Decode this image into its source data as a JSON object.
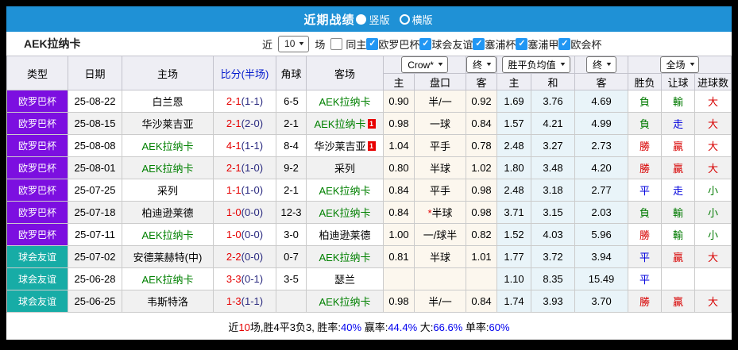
{
  "title_bar": {
    "title": "近期战绩",
    "radio_vertical_label": "竖版",
    "radio_horizontal_label": "横版",
    "bar_color": "#1f91d6"
  },
  "filter_bar": {
    "team": "AEK拉纳卡",
    "recent_label": "近",
    "recent_value": "10",
    "matches_label": "场",
    "same_home_label": "同主",
    "same_home_checked": false,
    "leagues": [
      {
        "label": "欧罗巴杯",
        "checked": true
      },
      {
        "label": "球会友谊",
        "checked": true
      },
      {
        "label": "塞浦杯",
        "checked": true
      },
      {
        "label": "塞浦甲",
        "checked": true
      },
      {
        "label": "欧会杯",
        "checked": true
      }
    ]
  },
  "table": {
    "main_columns": [
      "类型",
      "日期",
      "主场",
      "比分(半场)",
      "角球",
      "客场"
    ],
    "sub_columns": [
      "主",
      "盘口",
      "客",
      "主",
      "和",
      "客",
      "胜负",
      "让球",
      "进球数"
    ],
    "selects": {
      "company": "Crow*",
      "company_time": "终",
      "avg": "胜平负均值",
      "avg_time": "终",
      "scope": "全场"
    },
    "type_colors": {
      "欧罗巴杯": "#7c0fe0",
      "球会友谊": "#17aca6"
    },
    "value_colors": {
      "勝": "red",
      "贏": "red",
      "大": "red",
      "負": "green",
      "輸": "green",
      "小": "green",
      "平": "blue",
      "走": "blue"
    },
    "color_map": {
      "red": "#d80000",
      "green": "#007a00",
      "blue": "#0000dd"
    },
    "rows": [
      {
        "type": "欧罗巴杯",
        "date": "25-08-22",
        "home": "白兰恩",
        "home_main": false,
        "home_card": "",
        "score_ft": "2-1",
        "score_ht": "(1-1)",
        "corners": "6-5",
        "away": "AEK拉纳卡",
        "away_main": true,
        "away_card": "",
        "odds_home": "0.90",
        "handicap_star": false,
        "handicap": "半/一",
        "odds_away": "0.92",
        "avg_home": "1.69",
        "avg_draw": "3.76",
        "avg_away": "4.69",
        "result": "負",
        "handicap_result": "輸",
        "goals": "大"
      },
      {
        "type": "欧罗巴杯",
        "date": "25-08-15",
        "home": "华沙莱吉亚",
        "home_main": false,
        "home_card": "",
        "score_ft": "2-1",
        "score_ht": "(2-0)",
        "corners": "2-1",
        "away": "AEK拉纳卡",
        "away_main": true,
        "away_card": "1",
        "odds_home": "0.98",
        "handicap_star": false,
        "handicap": "一球",
        "odds_away": "0.84",
        "avg_home": "1.57",
        "avg_draw": "4.21",
        "avg_away": "4.99",
        "result": "負",
        "handicap_result": "走",
        "goals": "大"
      },
      {
        "type": "欧罗巴杯",
        "date": "25-08-08",
        "home": "AEK拉纳卡",
        "home_main": true,
        "home_card": "",
        "score_ft": "4-1",
        "score_ht": "(1-1)",
        "corners": "8-4",
        "away": "华沙莱吉亚",
        "away_main": false,
        "away_card": "1",
        "odds_home": "1.04",
        "handicap_star": false,
        "handicap": "平手",
        "odds_away": "0.78",
        "avg_home": "2.48",
        "avg_draw": "3.27",
        "avg_away": "2.73",
        "result": "勝",
        "handicap_result": "贏",
        "goals": "大"
      },
      {
        "type": "欧罗巴杯",
        "date": "25-08-01",
        "home": "AEK拉纳卡",
        "home_main": true,
        "home_card": "",
        "score_ft": "2-1",
        "score_ht": "(1-0)",
        "corners": "9-2",
        "away": "采列",
        "away_main": false,
        "away_card": "",
        "odds_home": "0.80",
        "handicap_star": false,
        "handicap": "半球",
        "odds_away": "1.02",
        "avg_home": "1.80",
        "avg_draw": "3.48",
        "avg_away": "4.20",
        "result": "勝",
        "handicap_result": "贏",
        "goals": "大"
      },
      {
        "type": "欧罗巴杯",
        "date": "25-07-25",
        "home": "采列",
        "home_main": false,
        "home_card": "",
        "score_ft": "1-1",
        "score_ht": "(1-0)",
        "corners": "2-1",
        "away": "AEK拉纳卡",
        "away_main": true,
        "away_card": "",
        "odds_home": "0.84",
        "handicap_star": false,
        "handicap": "平手",
        "odds_away": "0.98",
        "avg_home": "2.48",
        "avg_draw": "3.18",
        "avg_away": "2.77",
        "result": "平",
        "handicap_result": "走",
        "goals": "小"
      },
      {
        "type": "欧罗巴杯",
        "date": "25-07-18",
        "home": "柏迪逊莱德",
        "home_main": false,
        "home_card": "",
        "score_ft": "1-0",
        "score_ht": "(0-0)",
        "corners": "12-3",
        "away": "AEK拉纳卡",
        "away_main": true,
        "away_card": "",
        "odds_home": "0.84",
        "handicap_star": true,
        "handicap": "半球",
        "odds_away": "0.98",
        "avg_home": "3.71",
        "avg_draw": "3.15",
        "avg_away": "2.03",
        "result": "負",
        "handicap_result": "輸",
        "goals": "小"
      },
      {
        "type": "欧罗巴杯",
        "date": "25-07-11",
        "home": "AEK拉纳卡",
        "home_main": true,
        "home_card": "",
        "score_ft": "1-0",
        "score_ht": "(0-0)",
        "corners": "3-0",
        "away": "柏迪逊莱德",
        "away_main": false,
        "away_card": "",
        "odds_home": "1.00",
        "handicap_star": false,
        "handicap": "一/球半",
        "odds_away": "0.82",
        "avg_home": "1.52",
        "avg_draw": "4.03",
        "avg_away": "5.96",
        "result": "勝",
        "handicap_result": "輸",
        "goals": "小"
      },
      {
        "type": "球会友谊",
        "date": "25-07-02",
        "home": "安德莱赫特(中)",
        "home_main": false,
        "home_card": "",
        "score_ft": "2-2",
        "score_ht": "(0-0)",
        "corners": "0-7",
        "away": "AEK拉纳卡",
        "away_main": true,
        "away_card": "",
        "odds_home": "0.81",
        "handicap_star": false,
        "handicap": "半球",
        "odds_away": "1.01",
        "avg_home": "1.77",
        "avg_draw": "3.72",
        "avg_away": "3.94",
        "result": "平",
        "handicap_result": "贏",
        "goals": "大"
      },
      {
        "type": "球会友谊",
        "date": "25-06-28",
        "home": "AEK拉纳卡",
        "home_main": true,
        "home_card": "",
        "score_ft": "3-3",
        "score_ht": "(0-1)",
        "corners": "3-5",
        "away": "瑟兰",
        "away_main": false,
        "away_card": "",
        "odds_home": "",
        "handicap_star": false,
        "handicap": "",
        "odds_away": "",
        "avg_home": "1.10",
        "avg_draw": "8.35",
        "avg_away": "15.49",
        "result": "平",
        "handicap_result": "",
        "goals": ""
      },
      {
        "type": "球会友谊",
        "date": "25-06-25",
        "home": "韦斯特洛",
        "home_main": false,
        "home_card": "",
        "score_ft": "1-3",
        "score_ht": "(1-1)",
        "corners": "",
        "away": "AEK拉纳卡",
        "away_main": true,
        "away_card": "",
        "odds_home": "0.98",
        "handicap_star": false,
        "handicap": "半/一",
        "odds_away": "0.84",
        "avg_home": "1.74",
        "avg_draw": "3.93",
        "avg_away": "3.70",
        "result": "勝",
        "handicap_result": "贏",
        "goals": "大"
      }
    ]
  },
  "footer": {
    "segments": [
      {
        "text": "近",
        "color": "black"
      },
      {
        "text": "10",
        "color": "red"
      },
      {
        "text": "场,胜4平3负3, 胜率:",
        "color": "black"
      },
      {
        "text": "40%",
        "color": "blue"
      },
      {
        "text": " 赢率:",
        "color": "black"
      },
      {
        "text": "44.4%",
        "color": "blue"
      },
      {
        "text": " 大:",
        "color": "black"
      },
      {
        "text": "66.6%",
        "color": "blue"
      },
      {
        "text": " 单率:",
        "color": "black"
      },
      {
        "text": "60%",
        "color": "blue"
      }
    ]
  }
}
